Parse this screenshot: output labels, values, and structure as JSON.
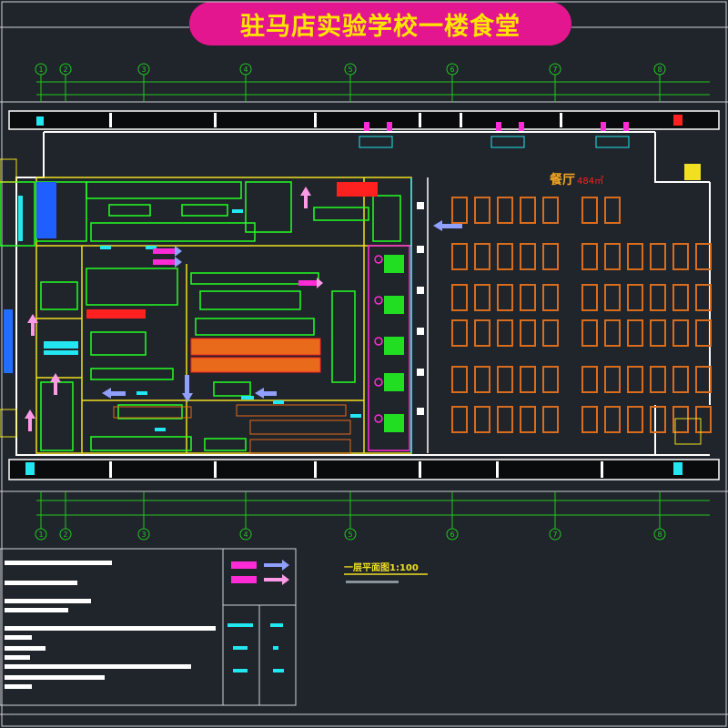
{
  "title": "驻马店实验学校一楼食堂",
  "labels": {
    "dining_hall": "餐厅",
    "dining_area": "484㎡",
    "plan_title": "一层平面图1:100"
  },
  "colors": {
    "background": "#20242b",
    "banner": "#e4168f",
    "banner_text": "#ffe600",
    "wall": "#ffffff",
    "wall_dark": "#0a0b0d",
    "axis": "#22c822",
    "equipment": "#22ff22",
    "cyan": "#22e6f0",
    "magenta": "#ff2bd6",
    "orange": "#e86a1a",
    "red": "#ff2020",
    "yellow": "#f0e020",
    "table": "#d86d1e"
  },
  "grid_axes": [
    "1",
    "2",
    "3",
    "4",
    "5",
    "6",
    "7",
    "8"
  ]
}
